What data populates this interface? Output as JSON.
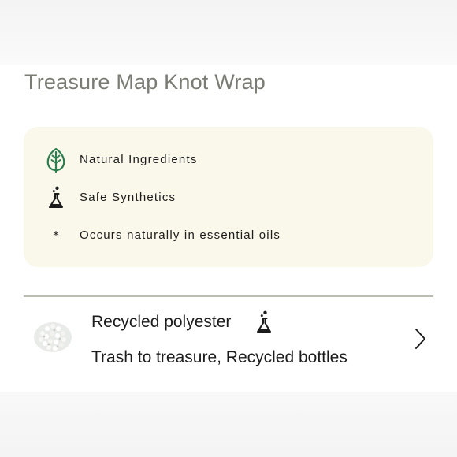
{
  "page": {
    "title": "Treasure Map Knot Wrap"
  },
  "legend": {
    "items": [
      {
        "icon": "leaf-icon",
        "label": "Natural Ingredients",
        "icon_color": "#2e7d4f"
      },
      {
        "icon": "flask-icon",
        "label": "Safe Synthetics",
        "icon_color": "#1c1c1c"
      },
      {
        "icon": "asterisk-icon",
        "symbol": "*",
        "label": "Occurs naturally in essential oils"
      }
    ],
    "background": "#faf7eb"
  },
  "materials": [
    {
      "name": "Recycled polyester",
      "description": "Trash to treasure, Recycled bottles",
      "tag_icon": "flask-icon",
      "thumbnail": "polyester-pellets-image"
    }
  ],
  "colors": {
    "title": "#7a7b73",
    "text": "#1c1c1c",
    "divider": "#bdbcb0"
  }
}
